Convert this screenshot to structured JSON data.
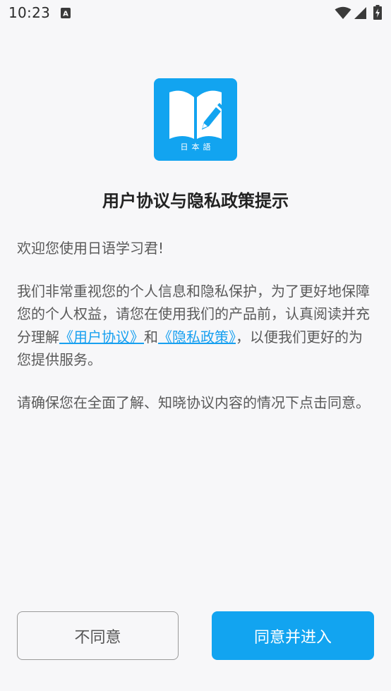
{
  "status_bar": {
    "time": "10:23",
    "notification_letter": "A"
  },
  "app": {
    "logo_caption": "日本語"
  },
  "dialog": {
    "title": "用户协议与隐私政策提示",
    "greeting": "欢迎您使用日语学习君!",
    "body_part1": "我们非常重视您的个人信息和隐私保护，为了更好地保障您的个人权益，请您在使用我们的产品前，认真阅读并充分理解",
    "user_agreement_link": "《用户协议》",
    "conjunction": "和",
    "privacy_policy_link": "《隐私政策》",
    "body_part2": "，以便我们更好的为您提供服务。",
    "confirm_text": "请确保您在全面了解、知晓协议内容的情况下点击同意。"
  },
  "buttons": {
    "disagree_label": "不同意",
    "agree_label": "同意并进入"
  },
  "colors": {
    "accent": "#12a4f0",
    "background": "#f7f7f9",
    "link": "#18a0f0"
  }
}
